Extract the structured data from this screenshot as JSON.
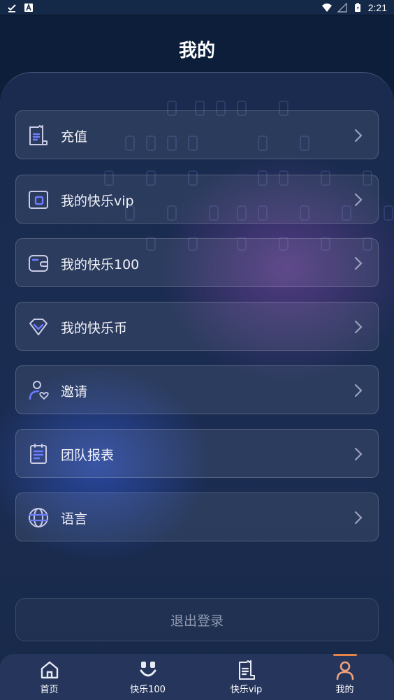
{
  "status_bar": {
    "time": "2:21"
  },
  "header": {
    "title": "我的"
  },
  "menu": {
    "items": [
      {
        "label": "充值",
        "icon": "receipt-icon"
      },
      {
        "label": "我的快乐vip",
        "icon": "vip-card-icon"
      },
      {
        "label": "我的快乐100",
        "icon": "wallet-icon"
      },
      {
        "label": "我的快乐币",
        "icon": "diamond-icon"
      },
      {
        "label": "邀请",
        "icon": "invite-user-icon"
      },
      {
        "label": "团队报表",
        "icon": "report-clipboard-icon"
      },
      {
        "label": "语言",
        "icon": "globe-icon"
      }
    ]
  },
  "logout": {
    "label": "退出登录"
  },
  "bottom_nav": {
    "items": [
      {
        "label": "首页",
        "icon": "home-icon"
      },
      {
        "label": "快乐100",
        "icon": "smile-icon"
      },
      {
        "label": "快乐vip",
        "icon": "receipt-icon"
      },
      {
        "label": "我的",
        "icon": "profile-icon",
        "active": true
      }
    ]
  },
  "colors": {
    "accent": "#6f7cff",
    "active_indicator": "#e58448",
    "background": "#102341"
  }
}
